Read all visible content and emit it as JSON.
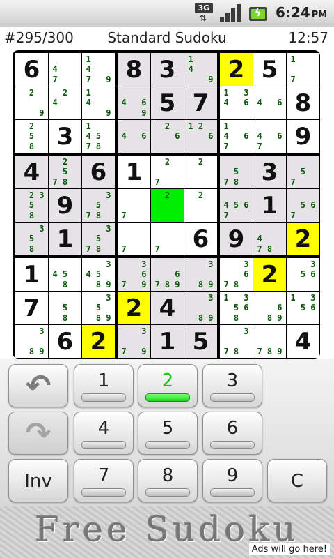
{
  "status_bar": {
    "network_label": "3G",
    "network_icon": "3g-data-icon",
    "signal_icon": "signal-strength-icon",
    "battery_icon": "battery-charging-icon",
    "time": "6:24",
    "ampm": "PM"
  },
  "header": {
    "puzzle_counter": "#295/300",
    "title": "Standard Sudoku",
    "timer": "12:57"
  },
  "board": {
    "colors": {
      "grid": "#000000",
      "shaded_cell": "#e6e3e6",
      "highlight": "#ffff00",
      "selected": "#00ee00",
      "note_digit": "#0a5a0a"
    },
    "cells": [
      [
        {
          "v": "6"
        },
        {
          "n": "47"
        },
        {
          "n": "1479"
        },
        {
          "v": "8"
        },
        {
          "v": "3"
        },
        {
          "n": "149"
        },
        {
          "v": "2",
          "h": 1
        },
        {
          "v": "5"
        },
        {
          "n": "17"
        }
      ],
      [
        {
          "n": "29"
        },
        {
          "n": "24"
        },
        {
          "n": "149"
        },
        {
          "n": "469"
        },
        {
          "v": "5"
        },
        {
          "v": "7"
        },
        {
          "n": "1346"
        },
        {
          "n": "46"
        },
        {
          "v": "8"
        }
      ],
      [
        {
          "n": "258"
        },
        {
          "v": "3"
        },
        {
          "n": "14578"
        },
        {
          "n": "46"
        },
        {
          "n": "26"
        },
        {
          "n": "126"
        },
        {
          "n": "1467"
        },
        {
          "n": "467"
        },
        {
          "v": "9"
        }
      ],
      [
        {
          "v": "4"
        },
        {
          "n": "2578"
        },
        {
          "v": "6"
        },
        {
          "v": "1"
        },
        {
          "n": "27"
        },
        {
          "n": "2"
        },
        {
          "n": "578"
        },
        {
          "v": "3"
        },
        {
          "n": "57"
        }
      ],
      [
        {
          "n": "2358"
        },
        {
          "v": "9"
        },
        {
          "n": "3578"
        },
        {
          "n": "7"
        },
        {
          "n": "2",
          "s": 1
        },
        {
          "n": "2"
        },
        {
          "n": "4567"
        },
        {
          "v": "1"
        },
        {
          "n": "567"
        }
      ],
      [
        {
          "n": "358"
        },
        {
          "v": "1"
        },
        {
          "n": "3578"
        },
        {
          "n": "7"
        },
        {
          "n": "7"
        },
        {
          "v": "6"
        },
        {
          "v": "9"
        },
        {
          "n": "478"
        },
        {
          "v": "2",
          "h": 1
        }
      ],
      [
        {
          "v": "1"
        },
        {
          "n": "458"
        },
        {
          "n": "34589"
        },
        {
          "n": "3679"
        },
        {
          "n": "6789"
        },
        {
          "n": "389"
        },
        {
          "n": "3678"
        },
        {
          "v": "2",
          "h": 1
        },
        {
          "n": "356"
        }
      ],
      [
        {
          "v": "7"
        },
        {
          "n": "58"
        },
        {
          "n": "3589"
        },
        {
          "v": "2",
          "h": 1
        },
        {
          "v": "4"
        },
        {
          "n": "389"
        },
        {
          "n": "13568"
        },
        {
          "n": "689"
        },
        {
          "n": "1356"
        }
      ],
      [
        {
          "n": "389"
        },
        {
          "v": "6"
        },
        {
          "v": "2",
          "h": 1
        },
        {
          "n": "379"
        },
        {
          "v": "1"
        },
        {
          "v": "5"
        },
        {
          "n": "378"
        },
        {
          "n": "789"
        },
        {
          "v": "4"
        }
      ]
    ]
  },
  "keypad": {
    "undo_icon": "undo-arrow-icon",
    "redo_icon": "redo-arrow-icon",
    "digits": [
      "1",
      "2",
      "3",
      "4",
      "5",
      "6",
      "7",
      "8",
      "9"
    ],
    "active_digit": "2",
    "inv_label": "Inv",
    "clear_label": "C"
  },
  "ad": {
    "title": "Free Sudoku",
    "note": "Ads will go here!"
  }
}
